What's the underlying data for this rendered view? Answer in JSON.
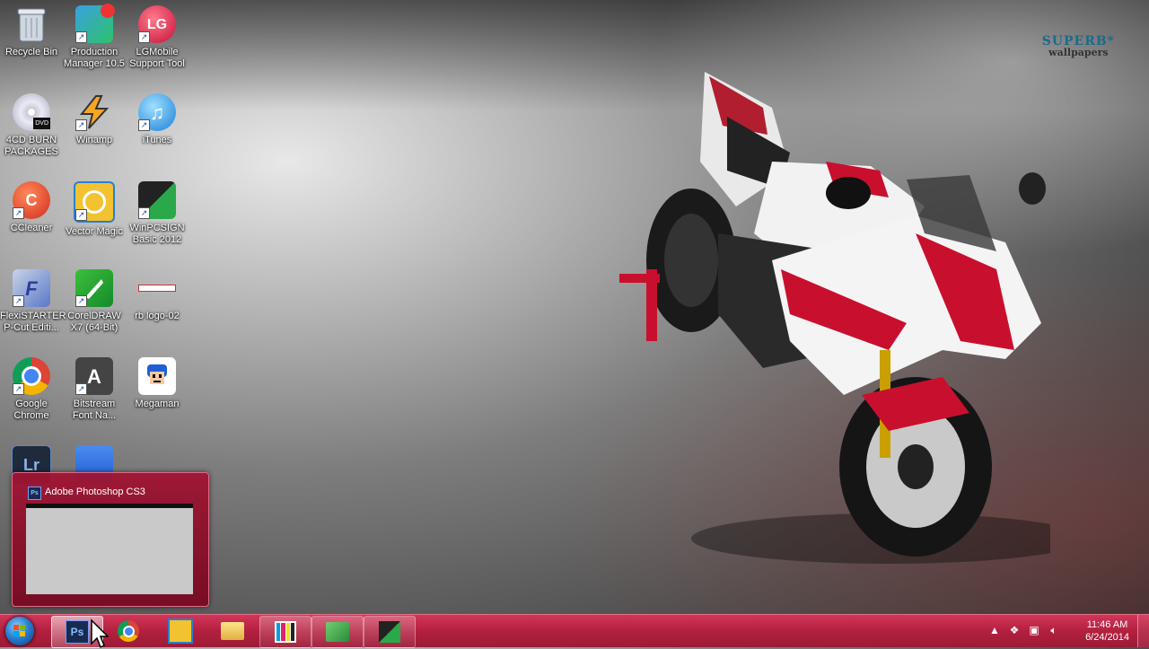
{
  "wallpaper": {
    "brand_top": "SUPERB*",
    "brand_bottom": "wallpapers"
  },
  "desktop_icons": [
    {
      "label": "Recycle Bin",
      "icon": "recycle-bin-icon"
    },
    {
      "label": "Production Manager 10.5",
      "icon": "production-manager-icon"
    },
    {
      "label": "LGMobile Support Tool",
      "icon": "lg-icon"
    },
    {
      "label": "4CD BURN PACKAGES",
      "icon": "dvd-icon"
    },
    {
      "label": "Winamp",
      "icon": "winamp-icon"
    },
    {
      "label": "iTunes",
      "icon": "itunes-icon"
    },
    {
      "label": "CCleaner",
      "icon": "ccleaner-icon"
    },
    {
      "label": "Vector Magic",
      "icon": "vector-magic-icon"
    },
    {
      "label": "WinPCSIGN Basic 2012",
      "icon": "winpcsign-icon"
    },
    {
      "label": "FlexiSTARTER P-Cut Editi...",
      "icon": "flexistarter-icon"
    },
    {
      "label": "CorelDRAW X7 (64-Bit)",
      "icon": "coreldraw-icon"
    },
    {
      "label": "rb logo-02",
      "icon": "image-file-icon"
    },
    {
      "label": "Google Chrome",
      "icon": "chrome-icon"
    },
    {
      "label": "Bitstream Font Na...",
      "icon": "bitstream-icon"
    },
    {
      "label": "Megaman",
      "icon": "megaman-icon"
    }
  ],
  "thumbnail_preview": {
    "title": "Adobe Photoshop CS3"
  },
  "taskbar": {
    "buttons": [
      {
        "name": "photoshop",
        "label": "Ps"
      },
      {
        "name": "chrome",
        "label": ""
      },
      {
        "name": "vector-magic",
        "label": ""
      },
      {
        "name": "explorer",
        "label": ""
      },
      {
        "name": "color-app",
        "label": ""
      },
      {
        "name": "cutter-app",
        "label": ""
      },
      {
        "name": "winpcsign",
        "label": ""
      }
    ],
    "clock_time": "11:46 AM",
    "clock_date": "6/24/2014"
  },
  "colors": {
    "taskbar": "#b3203f",
    "preview": "#a0143a"
  }
}
